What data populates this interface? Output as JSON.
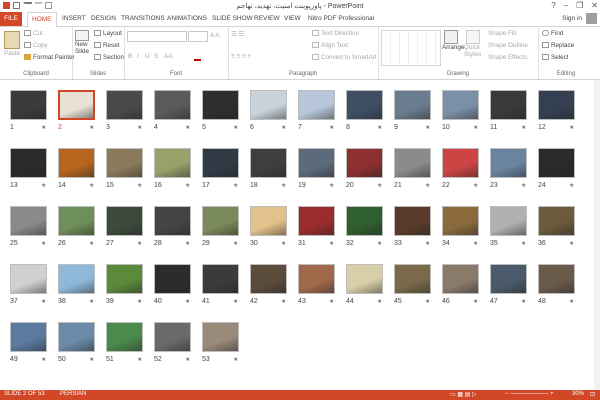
{
  "window": {
    "title": "پاورپوینت امنیت، تهدید، تهاجم - PowerPoint",
    "sign_in": "Sign in",
    "controls": [
      "?",
      "–",
      "❐",
      "✕"
    ]
  },
  "tabs": [
    {
      "label": "FILE"
    },
    {
      "label": "HOME"
    },
    {
      "label": "INSERT"
    },
    {
      "label": "DESIGN"
    },
    {
      "label": "TRANSITIONS"
    },
    {
      "label": "ANIMATIONS"
    },
    {
      "label": "SLIDE SHOW"
    },
    {
      "label": "REVIEW"
    },
    {
      "label": "VIEW"
    },
    {
      "label": "Nitro PDF Professional"
    }
  ],
  "ribbon": {
    "clipboard": {
      "paste": "Paste",
      "cut": "Cut",
      "copy": "Copy",
      "format_painter": "Format Painter",
      "label": "Clipboard"
    },
    "slides": {
      "new_slide": "New Slide",
      "layout": "Layout",
      "reset": "Reset",
      "section": "Section",
      "label": "Slides"
    },
    "font": {
      "label": "Font",
      "bold": "B",
      "italic": "I",
      "underline": "U",
      "strike": "S",
      "aa": "AA"
    },
    "paragraph": {
      "label": "Paragraph",
      "text_direction": "Text Direction",
      "align_text": "Align Text",
      "smartart": "Convert to SmartArt"
    },
    "drawing": {
      "label": "Drawing",
      "arrange": "Arrange",
      "quick_styles": "Quick Styles",
      "shape_fill": "Shape Fill",
      "shape_outline": "Shape Outline",
      "shape_effects": "Shape Effects"
    },
    "editing": {
      "label": "Editing",
      "find": "Find",
      "replace": "Replace",
      "select": "Select"
    }
  },
  "slides": {
    "selected": 2,
    "items": [
      {
        "n": "1",
        "c": "#3b3b3b"
      },
      {
        "n": "2",
        "c": "#e8e2d6"
      },
      {
        "n": "3",
        "c": "#4a4a4a"
      },
      {
        "n": "4",
        "c": "#5a5a5a"
      },
      {
        "n": "5",
        "c": "#2e2e2e"
      },
      {
        "n": "6",
        "c": "#c9d3dc"
      },
      {
        "n": "7",
        "c": "#b7c6d8"
      },
      {
        "n": "8",
        "c": "#3e4f63"
      },
      {
        "n": "9",
        "c": "#6a7d8f"
      },
      {
        "n": "10",
        "c": "#7b8fa6"
      },
      {
        "n": "11",
        "c": "#3a3a3a"
      },
      {
        "n": "12",
        "c": "#344052"
      },
      {
        "n": "13",
        "c": "#2b2b2b"
      },
      {
        "n": "14",
        "c": "#b5651d"
      },
      {
        "n": "15",
        "c": "#8a7a5a"
      },
      {
        "n": "16",
        "c": "#9aa06a"
      },
      {
        "n": "17",
        "c": "#2f3a45"
      },
      {
        "n": "18",
        "c": "#3e3e3e"
      },
      {
        "n": "19",
        "c": "#5b6b7b"
      },
      {
        "n": "20",
        "c": "#8c2f2f"
      },
      {
        "n": "21",
        "c": "#8b8b8b"
      },
      {
        "n": "22",
        "c": "#c44"
      },
      {
        "n": "23",
        "c": "#6a84a0"
      },
      {
        "n": "24",
        "c": "#2a2a2a"
      },
      {
        "n": "25",
        "c": "#8a8a8a"
      },
      {
        "n": "26",
        "c": "#6f8f5a"
      },
      {
        "n": "27",
        "c": "#3c4a3c"
      },
      {
        "n": "28",
        "c": "#444"
      },
      {
        "n": "29",
        "c": "#7a8a5a"
      },
      {
        "n": "30",
        "c": "#e2c18c"
      },
      {
        "n": "31",
        "c": "#9c2b2b"
      },
      {
        "n": "32",
        "c": "#2f5f2f"
      },
      {
        "n": "33",
        "c": "#5a3b2b"
      },
      {
        "n": "34",
        "c": "#8c6a3c"
      },
      {
        "n": "35",
        "c": "#b0b0b0"
      },
      {
        "n": "36",
        "c": "#6b5a3b"
      },
      {
        "n": "37",
        "c": "#d0d0d0"
      },
      {
        "n": "38",
        "c": "#8fb8d8"
      },
      {
        "n": "39",
        "c": "#5a8a3a"
      },
      {
        "n": "40",
        "c": "#2c2c2c"
      },
      {
        "n": "41",
        "c": "#3b3b3b"
      },
      {
        "n": "42",
        "c": "#5b4b3b"
      },
      {
        "n": "43",
        "c": "#a06a4a"
      },
      {
        "n": "44",
        "c": "#d8cfa8"
      },
      {
        "n": "45",
        "c": "#7a6a4a"
      },
      {
        "n": "46",
        "c": "#8a7a6a"
      },
      {
        "n": "47",
        "c": "#4a5a6a"
      },
      {
        "n": "48",
        "c": "#6a5a4a"
      },
      {
        "n": "49",
        "c": "#5a7aa0"
      },
      {
        "n": "50",
        "c": "#6a8aa8"
      },
      {
        "n": "51",
        "c": "#4a8a4a"
      },
      {
        "n": "52",
        "c": "#6a6a6a"
      },
      {
        "n": "53",
        "c": "#9a8a7a"
      }
    ]
  },
  "status": {
    "slide_info": "SLIDE 2 OF 53",
    "language": "PERSIAN",
    "zoom": "30%"
  },
  "colors": {
    "accent": "#d24726"
  }
}
